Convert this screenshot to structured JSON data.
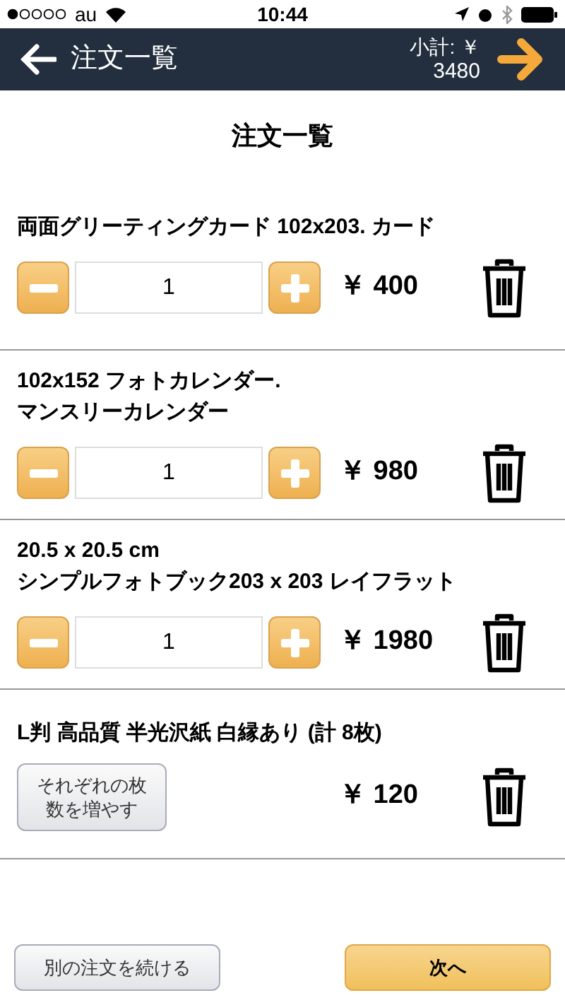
{
  "status_bar": {
    "carrier": "au",
    "time": "10:44"
  },
  "nav_bar": {
    "back_label": "注文一覧",
    "subtotal_label": "小計: ￥",
    "subtotal_value": "3480"
  },
  "page_title": "注文一覧",
  "items": [
    {
      "kind": "stepper",
      "title_lines": [
        "両面グリーティングカード 102x203. カード"
      ],
      "quantity": "1",
      "price": "￥ 400"
    },
    {
      "kind": "stepper",
      "title_lines": [
        "102x152 フォトカレンダー.",
        "マンスリーカレンダー"
      ],
      "quantity": "1",
      "price": "￥ 980"
    },
    {
      "kind": "stepper",
      "title_lines": [
        "20.5 x 20.5 cm",
        "シンプルフォトブック203 x 203 レイフラット"
      ],
      "quantity": "1",
      "price": "￥ 1980"
    },
    {
      "kind": "button",
      "title_lines": [
        "L判 高品質 半光沢紙 白縁あり (計 8枚)"
      ],
      "button_lines": [
        "それぞれの枚",
        "数を増やす"
      ],
      "price": "￥ 120"
    }
  ],
  "footer": {
    "secondary_button": "別の注文を続ける",
    "primary_button": "次へ"
  }
}
